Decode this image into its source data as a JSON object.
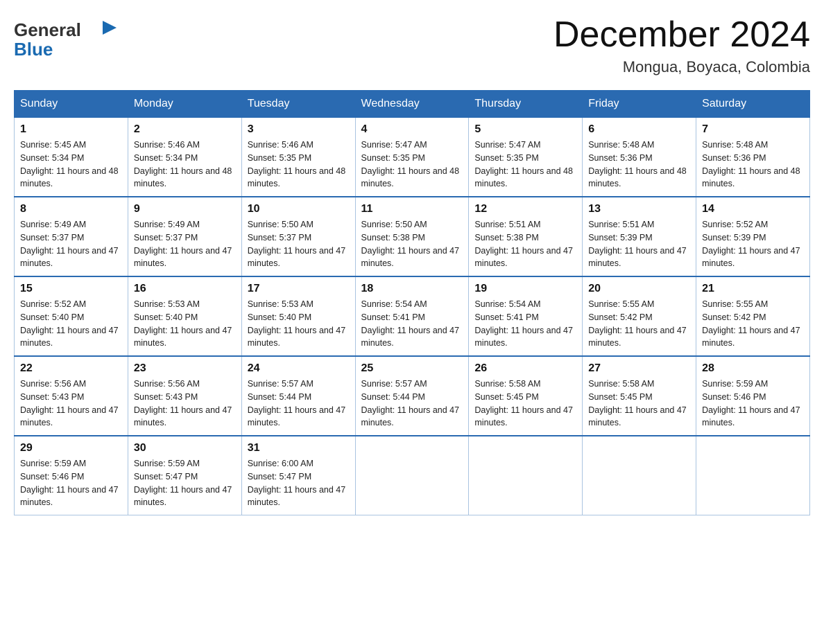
{
  "header": {
    "logo": {
      "general": "General",
      "blue": "Blue",
      "arrow_unicode": "▶"
    },
    "title": "December 2024",
    "location": "Mongua, Boyaca, Colombia"
  },
  "days_of_week": [
    "Sunday",
    "Monday",
    "Tuesday",
    "Wednesday",
    "Thursday",
    "Friday",
    "Saturday"
  ],
  "weeks": [
    [
      {
        "day": "1",
        "sunrise": "5:45 AM",
        "sunset": "5:34 PM",
        "daylight": "11 hours and 48 minutes."
      },
      {
        "day": "2",
        "sunrise": "5:46 AM",
        "sunset": "5:34 PM",
        "daylight": "11 hours and 48 minutes."
      },
      {
        "day": "3",
        "sunrise": "5:46 AM",
        "sunset": "5:35 PM",
        "daylight": "11 hours and 48 minutes."
      },
      {
        "day": "4",
        "sunrise": "5:47 AM",
        "sunset": "5:35 PM",
        "daylight": "11 hours and 48 minutes."
      },
      {
        "day": "5",
        "sunrise": "5:47 AM",
        "sunset": "5:35 PM",
        "daylight": "11 hours and 48 minutes."
      },
      {
        "day": "6",
        "sunrise": "5:48 AM",
        "sunset": "5:36 PM",
        "daylight": "11 hours and 48 minutes."
      },
      {
        "day": "7",
        "sunrise": "5:48 AM",
        "sunset": "5:36 PM",
        "daylight": "11 hours and 48 minutes."
      }
    ],
    [
      {
        "day": "8",
        "sunrise": "5:49 AM",
        "sunset": "5:37 PM",
        "daylight": "11 hours and 47 minutes."
      },
      {
        "day": "9",
        "sunrise": "5:49 AM",
        "sunset": "5:37 PM",
        "daylight": "11 hours and 47 minutes."
      },
      {
        "day": "10",
        "sunrise": "5:50 AM",
        "sunset": "5:37 PM",
        "daylight": "11 hours and 47 minutes."
      },
      {
        "day": "11",
        "sunrise": "5:50 AM",
        "sunset": "5:38 PM",
        "daylight": "11 hours and 47 minutes."
      },
      {
        "day": "12",
        "sunrise": "5:51 AM",
        "sunset": "5:38 PM",
        "daylight": "11 hours and 47 minutes."
      },
      {
        "day": "13",
        "sunrise": "5:51 AM",
        "sunset": "5:39 PM",
        "daylight": "11 hours and 47 minutes."
      },
      {
        "day": "14",
        "sunrise": "5:52 AM",
        "sunset": "5:39 PM",
        "daylight": "11 hours and 47 minutes."
      }
    ],
    [
      {
        "day": "15",
        "sunrise": "5:52 AM",
        "sunset": "5:40 PM",
        "daylight": "11 hours and 47 minutes."
      },
      {
        "day": "16",
        "sunrise": "5:53 AM",
        "sunset": "5:40 PM",
        "daylight": "11 hours and 47 minutes."
      },
      {
        "day": "17",
        "sunrise": "5:53 AM",
        "sunset": "5:40 PM",
        "daylight": "11 hours and 47 minutes."
      },
      {
        "day": "18",
        "sunrise": "5:54 AM",
        "sunset": "5:41 PM",
        "daylight": "11 hours and 47 minutes."
      },
      {
        "day": "19",
        "sunrise": "5:54 AM",
        "sunset": "5:41 PM",
        "daylight": "11 hours and 47 minutes."
      },
      {
        "day": "20",
        "sunrise": "5:55 AM",
        "sunset": "5:42 PM",
        "daylight": "11 hours and 47 minutes."
      },
      {
        "day": "21",
        "sunrise": "5:55 AM",
        "sunset": "5:42 PM",
        "daylight": "11 hours and 47 minutes."
      }
    ],
    [
      {
        "day": "22",
        "sunrise": "5:56 AM",
        "sunset": "5:43 PM",
        "daylight": "11 hours and 47 minutes."
      },
      {
        "day": "23",
        "sunrise": "5:56 AM",
        "sunset": "5:43 PM",
        "daylight": "11 hours and 47 minutes."
      },
      {
        "day": "24",
        "sunrise": "5:57 AM",
        "sunset": "5:44 PM",
        "daylight": "11 hours and 47 minutes."
      },
      {
        "day": "25",
        "sunrise": "5:57 AM",
        "sunset": "5:44 PM",
        "daylight": "11 hours and 47 minutes."
      },
      {
        "day": "26",
        "sunrise": "5:58 AM",
        "sunset": "5:45 PM",
        "daylight": "11 hours and 47 minutes."
      },
      {
        "day": "27",
        "sunrise": "5:58 AM",
        "sunset": "5:45 PM",
        "daylight": "11 hours and 47 minutes."
      },
      {
        "day": "28",
        "sunrise": "5:59 AM",
        "sunset": "5:46 PM",
        "daylight": "11 hours and 47 minutes."
      }
    ],
    [
      {
        "day": "29",
        "sunrise": "5:59 AM",
        "sunset": "5:46 PM",
        "daylight": "11 hours and 47 minutes."
      },
      {
        "day": "30",
        "sunrise": "5:59 AM",
        "sunset": "5:47 PM",
        "daylight": "11 hours and 47 minutes."
      },
      {
        "day": "31",
        "sunrise": "6:00 AM",
        "sunset": "5:47 PM",
        "daylight": "11 hours and 47 minutes."
      },
      null,
      null,
      null,
      null
    ]
  ]
}
